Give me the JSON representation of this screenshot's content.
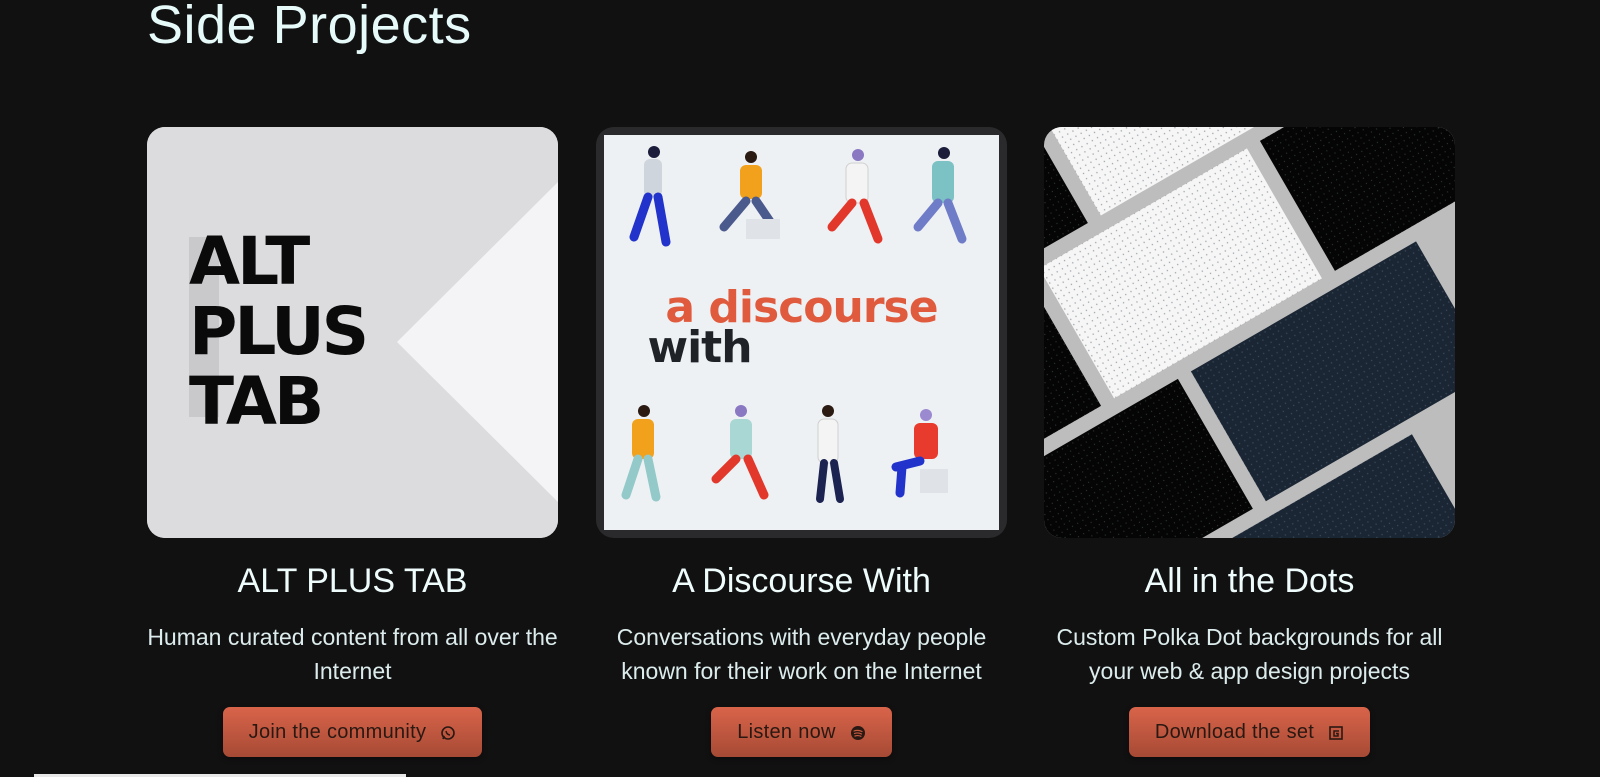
{
  "section": {
    "title": "Side Projects"
  },
  "projects": [
    {
      "logo_lines": [
        "ALT",
        "PLUS",
        "TAB"
      ],
      "title": "ALT PLUS TAB",
      "description": "Human curated content from all over the Internet",
      "cta_label": "Join the community",
      "cta_icon": "whatsapp-icon"
    },
    {
      "logo_line1": "a discourse",
      "logo_line2": "with",
      "title": "A Discourse With",
      "description": "Conversations with everyday people known for their work on the Internet",
      "cta_label": "Listen now",
      "cta_icon": "spotify-icon"
    },
    {
      "title": "All in the Dots",
      "description": "Custom Polka Dot backgrounds for all your web & app design projects",
      "cta_label": "Download the set",
      "cta_icon": "gumroad-icon"
    }
  ],
  "colors": {
    "background": "#121112",
    "heading": "#e6fafa",
    "button_top": "#d9644a",
    "button_bottom": "#a64a35",
    "discourse_orange": "#e05a3d",
    "discourse_dark": "#1f2328"
  }
}
